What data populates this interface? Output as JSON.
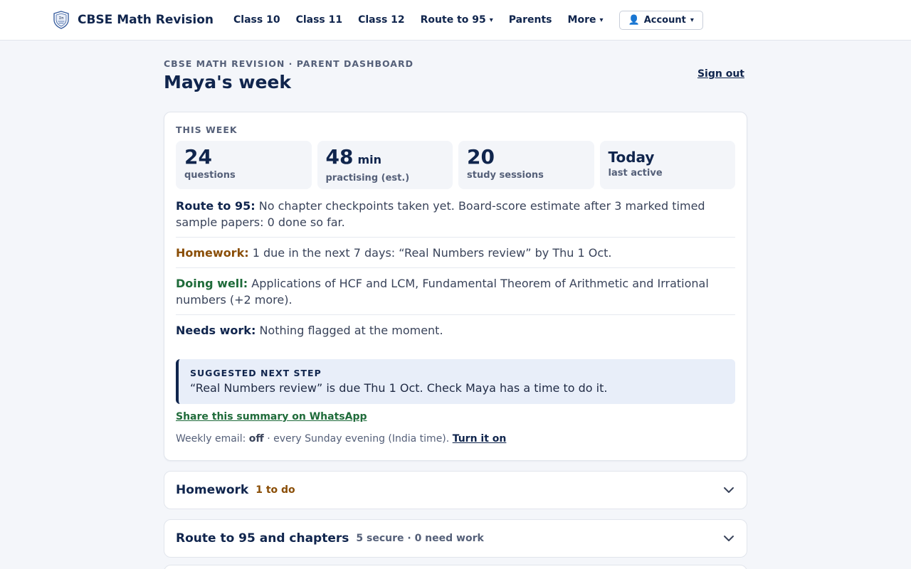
{
  "brand": {
    "name": "CBSE Math Revision",
    "logo_icon": "shield-crest-icon"
  },
  "nav": {
    "items": [
      {
        "label": "Class 10",
        "dropdown": false
      },
      {
        "label": "Class 11",
        "dropdown": false
      },
      {
        "label": "Class 12",
        "dropdown": false
      },
      {
        "label": "Route to 95",
        "dropdown": true
      },
      {
        "label": "Parents",
        "dropdown": false
      },
      {
        "label": "More",
        "dropdown": true
      }
    ],
    "account_label": "Account",
    "caret": "▾"
  },
  "page": {
    "eyebrow": "CBSE MATH REVISION · PARENT DASHBOARD",
    "title": "Maya's week",
    "signout": "Sign out"
  },
  "week": {
    "label": "THIS WEEK",
    "stats": [
      {
        "value": "24",
        "unit": "",
        "label": "questions"
      },
      {
        "value": "48",
        "unit": "min",
        "label": "practising (est.)"
      },
      {
        "value": "20",
        "unit": "",
        "label": "study sessions"
      },
      {
        "value": "Today",
        "unit": "",
        "label": "last active"
      }
    ],
    "rows": [
      {
        "key": "Route to 95:",
        "text": "No chapter checkpoints taken yet. Board-score estimate after 3 marked timed sample papers: 0 done so far."
      },
      {
        "key": "Homework:",
        "text": "1 due in the next 7 days: “Real Numbers review” by Thu 1 Oct."
      },
      {
        "key": "Doing well:",
        "text": "Applications of HCF and LCM, Fundamental Theorem of Arithmetic and Irrational numbers (+2 more)."
      },
      {
        "key": "Needs work:",
        "text": "Nothing flagged at the moment."
      }
    ],
    "suggest": {
      "label": "SUGGESTED NEXT STEP",
      "text": "“Real Numbers review” is due Thu 1 Oct. Check Maya has a time to do it."
    },
    "whatsapp": "Share this summary on WhatsApp",
    "email": {
      "prefix": "Weekly email:",
      "state": "off",
      "suffix": "· every Sunday evening (India time).",
      "action": "Turn it on"
    }
  },
  "accordions": [
    {
      "title": "Homework",
      "badge": "1 to do"
    },
    {
      "title": "Route to 95 and chapters",
      "badge": "5 secure · 0 need work"
    }
  ],
  "colors": {
    "navy": "#10254d",
    "homework": "#8a4e07",
    "good": "#1f6b3a",
    "page_bg": "#f4f6fa"
  }
}
